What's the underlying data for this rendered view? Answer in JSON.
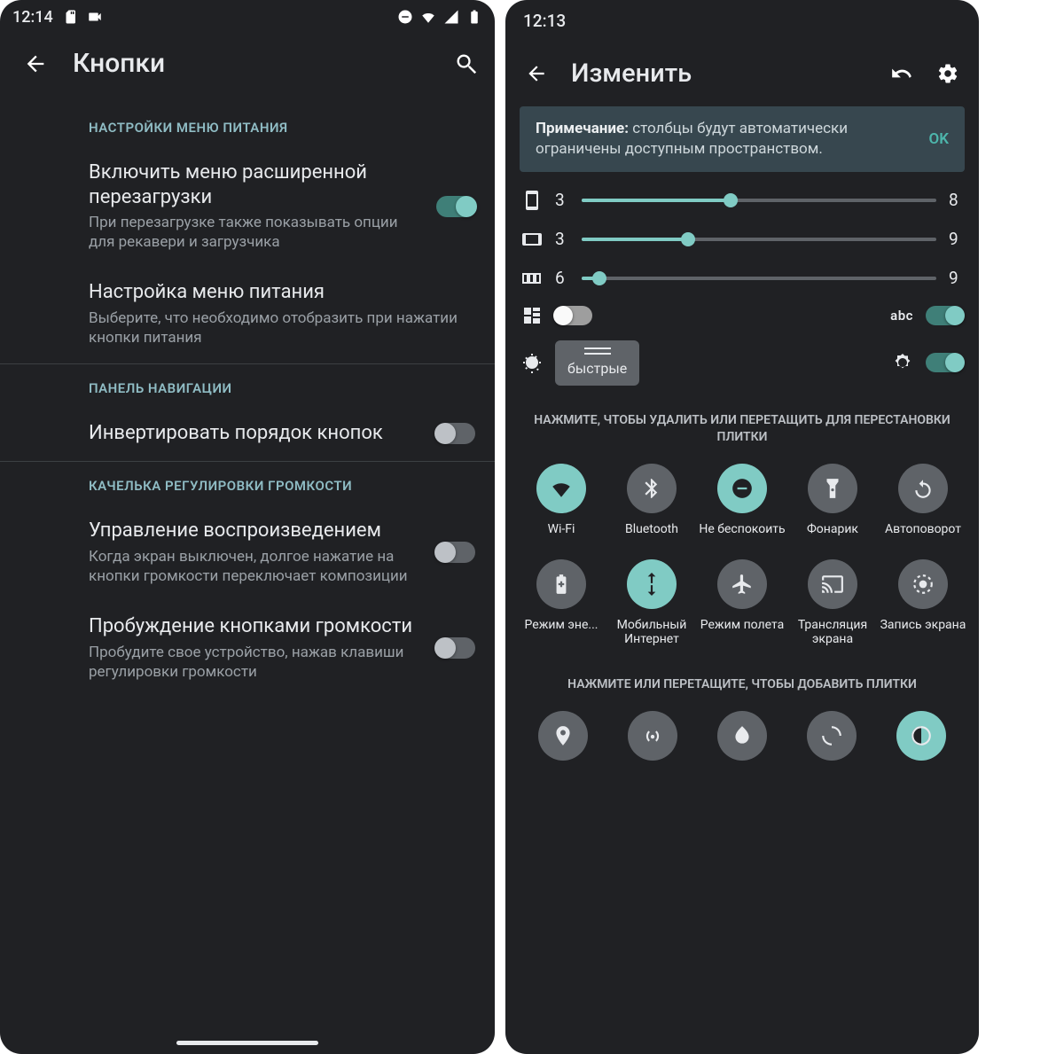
{
  "left": {
    "status_time": "12:14",
    "title": "Кнопки",
    "sections": {
      "power": {
        "header": "НАСТРОЙКИ МЕНЮ ПИТАНИЯ",
        "advanced_reboot_title": "Включить меню расширенной перезагрузки",
        "advanced_reboot_sub": "При перезагрузке также показывать опции для рекавери и загрузчика",
        "power_menu_title": "Настройка меню питания",
        "power_menu_sub": "Выберите, что необходимо отобразить при нажатии кнопки питания"
      },
      "nav": {
        "header": "ПАНЕЛЬ НАВИГАЦИИ",
        "invert_title": "Инвертировать порядок кнопок"
      },
      "volume": {
        "header": "КАЧЕЛЬКА РЕГУЛИРОВКИ ГРОМКОСТИ",
        "playback_title": "Управление воспроизведением",
        "playback_sub": "Когда экран выключен, долгое нажатие на кнопки громкости переключает композиции",
        "wake_title": "Пробуждение кнопками громкости",
        "wake_sub": "Пробудите свое устройство, нажав клавиши регулировки громкости"
      }
    }
  },
  "right": {
    "status_time": "12:13",
    "title": "Изменить",
    "note_bold": "Примечание:",
    "note_rest": " столбцы будут автоматически ограничены доступным пространством.",
    "note_ok": "OK",
    "sliders": {
      "portrait": {
        "value": "3",
        "max": "8",
        "pct": 42
      },
      "landscape": {
        "value": "3",
        "max": "9",
        "pct": 30
      },
      "wide": {
        "value": "6",
        "max": "9",
        "pct": 5
      }
    },
    "abc_label": "abc",
    "chip_label": "быстрые",
    "hint_remove": "НАЖМИТЕ, ЧТОБЫ УДАЛИТЬ ИЛИ ПЕРЕТАЩИТЬ ДЛЯ ПЕРЕСТАНОВКИ ПЛИТКИ",
    "hint_add": "НАЖМИТЕ ИЛИ ПЕРЕТАЩИТЕ, ЧТОБЫ ДОБАВИТЬ ПЛИТКИ",
    "tiles_row1": [
      {
        "label": "Wi-Fi",
        "active": true
      },
      {
        "label": "Bluetooth",
        "active": false
      },
      {
        "label": "Не беспокоить",
        "active": true
      },
      {
        "label": "Фонарик",
        "active": false
      },
      {
        "label": "Автоповорот",
        "active": false
      }
    ],
    "tiles_row2": [
      {
        "label": "Режим эне...",
        "active": false
      },
      {
        "label": "Мобильный Интернет",
        "active": true
      },
      {
        "label": "Режим полета",
        "active": false
      },
      {
        "label": "Трансляция экрана",
        "active": false
      },
      {
        "label": "Запись экрана",
        "active": false
      }
    ]
  }
}
